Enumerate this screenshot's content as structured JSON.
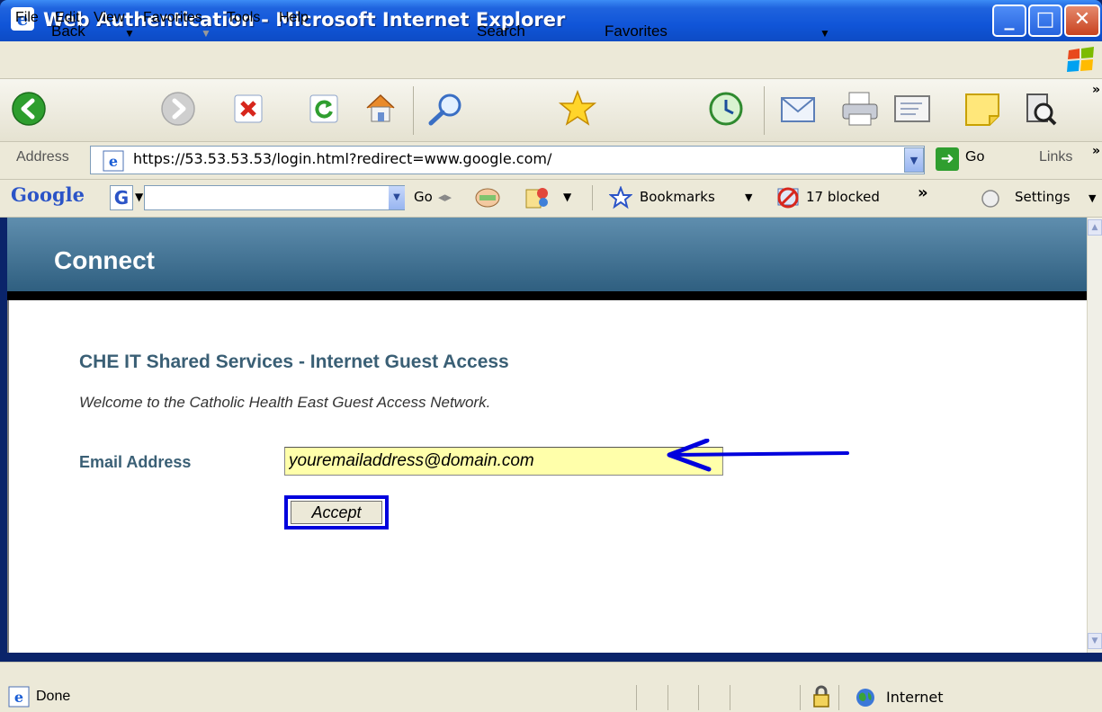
{
  "window": {
    "title": "Web Authentication - Microsoft Internet Explorer"
  },
  "menu": {
    "items": [
      "File",
      "Edit",
      "View",
      "Favorites",
      "Tools",
      "Help"
    ]
  },
  "toolbar": {
    "back_label": "Back",
    "search_label": "Search",
    "favorites_label": "Favorites"
  },
  "address_bar": {
    "label": "Address",
    "url": "https://53.53.53.53/login.html?redirect=www.google.com/",
    "go_label": "Go",
    "links_label": "Links"
  },
  "google_toolbar": {
    "logo": "Google",
    "go_label": "Go",
    "bookmarks_label": "Bookmarks",
    "blocked_label": "17 blocked",
    "more_label": "»",
    "settings_label": "Settings"
  },
  "page": {
    "banner_title": "Connect",
    "heading": "CHE IT Shared Services - Internet Guest Access",
    "welcome": "Welcome to the Catholic Health East Guest Access Network.",
    "email_label": "Email Address",
    "email_value": "youremailaddress@domain.com",
    "accept_label": "Accept"
  },
  "status_bar": {
    "status": "Done",
    "zone": "Internet"
  },
  "colors": {
    "banner": "#2f5f80",
    "heading": "#3a5f75",
    "input_bg": "#ffffaa",
    "highlight": "#0000dd"
  }
}
